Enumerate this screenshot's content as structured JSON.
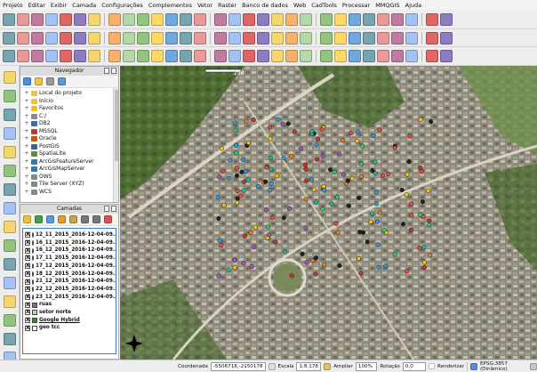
{
  "menu": [
    "Projeto",
    "Editar",
    "Exibir",
    "Camada",
    "Configurações",
    "Complementos",
    "Vetor",
    "Raster",
    "Banco de dados",
    "Web",
    "CadTools",
    "Processar",
    "MMQGIS",
    "Ajuda"
  ],
  "navigator": {
    "title": "Navegador",
    "items": [
      {
        "label": "Local do projeto",
        "icon": "folder-icon",
        "color": "#e8c34a"
      },
      {
        "label": "Início",
        "icon": "folder-icon",
        "color": "#e8c34a"
      },
      {
        "label": "Favoritos",
        "icon": "star-icon",
        "color": "#f0c020"
      },
      {
        "label": "C:/",
        "icon": "drive-icon",
        "color": "#8a8a8a"
      },
      {
        "label": "DB2",
        "icon": "db2-icon",
        "color": "#3b6db3"
      },
      {
        "label": "MSSQL",
        "icon": "mssql-icon",
        "color": "#c0392b"
      },
      {
        "label": "Oracle",
        "icon": "oracle-icon",
        "color": "#d35400"
      },
      {
        "label": "PostGIS",
        "icon": "postgis-icon",
        "color": "#336791"
      },
      {
        "label": "SpatiaLite",
        "icon": "spatialite-icon",
        "color": "#5a8f3d"
      },
      {
        "label": "ArcGisFeatureServer",
        "icon": "arcgis-icon",
        "color": "#2c7bb6"
      },
      {
        "label": "ArcGisMapServer",
        "icon": "arcgis-icon",
        "color": "#2c7bb6"
      },
      {
        "label": "OWS",
        "icon": "ows-icon",
        "color": "#7f8c8d"
      },
      {
        "label": "Tile Server (XYZ)",
        "icon": "xyz-icon",
        "color": "#7f8c8d"
      },
      {
        "label": "WCS",
        "icon": "wcs-icon",
        "color": "#7f8c8d"
      }
    ]
  },
  "layers_panel": {
    "title": "Camadas",
    "layers": [
      {
        "name": "12_11_2015_2016-12-04-09...",
        "color": "#222222",
        "checked": "X"
      },
      {
        "name": "16_11_2015_2016-12-04-09...",
        "color": "#2ecc71",
        "checked": "X"
      },
      {
        "name": "16_12_2015_2016-12-04-09...",
        "color": "#f1c40f",
        "checked": "X"
      },
      {
        "name": "17_11_2015_2016-12-04-09...",
        "color": "#e74c3c",
        "checked": "X"
      },
      {
        "name": "17_12_2015_2016-12-04-09...",
        "color": "#3498db",
        "checked": "X"
      },
      {
        "name": "18_12_2015_2016-12-04-09...",
        "color": "#9b59b6",
        "checked": "X"
      },
      {
        "name": "21_12_2015_2016-12-04-09...",
        "color": "#e67e22",
        "checked": "X"
      },
      {
        "name": "22_12_2015_2016-12-04-09...",
        "color": "#c0392b",
        "checked": "X"
      },
      {
        "name": "23_12_2015_2016-12-04-09...",
        "color": "#1abc9c",
        "checked": "X"
      },
      {
        "name": "ruas",
        "color": "#777777",
        "checked": "X"
      },
      {
        "name": "setor norte",
        "color": "#cccccc",
        "checked": "X"
      },
      {
        "name": "Google Hybrid",
        "color": "#4a7f3f",
        "checked": "X"
      },
      {
        "name": "geo tcc",
        "color": "#ffffff",
        "checked": "X"
      }
    ]
  },
  "map": {
    "scale_bar_label": "250"
  },
  "status": {
    "coord_label": "Coordenada",
    "coord_value": "-5506718,-2150178",
    "scale_label": "Escala",
    "scale_value": "1:8.178",
    "magnify_label": "Ampliar",
    "magnify_value": "100%",
    "rotation_label": "Rotação",
    "rotation_value": "0,0",
    "render_label": "Renderizar",
    "crs": "EPSG:3857 (Dinâmico)"
  }
}
